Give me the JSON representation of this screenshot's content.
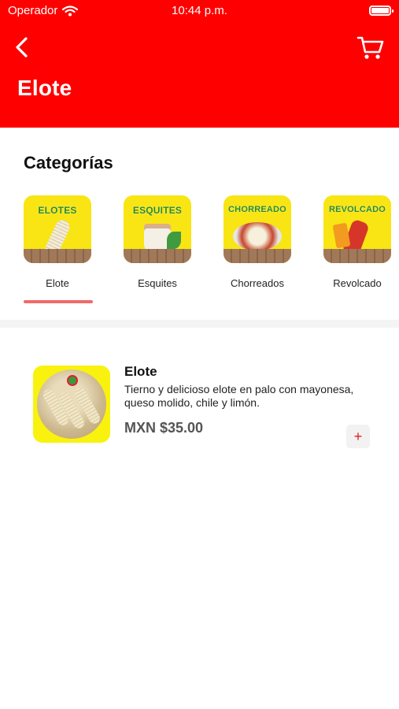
{
  "status_bar": {
    "carrier": "Operador",
    "time": "10:44 p.m."
  },
  "header": {
    "title": "Elote",
    "back_icon": "chevron-left-icon",
    "cart_icon": "cart-icon"
  },
  "categories_section": {
    "title": "Categorías",
    "selected_index": 0,
    "items": [
      {
        "label": "Elote",
        "image_text": "ELOTES"
      },
      {
        "label": "Esquites",
        "image_text": "ESQUITES"
      },
      {
        "label": "Chorreados",
        "image_text": "CHORREADO"
      },
      {
        "label": "Revolcado",
        "image_text": "REVOLCADO"
      }
    ]
  },
  "products": [
    {
      "name": "Elote",
      "description": "Tierno y delicioso elote en palo con mayonesa, queso molido, chile y limón.",
      "price": "MXN $35.00",
      "add_label": "+"
    }
  ],
  "colors": {
    "brand_red": "#ff0000",
    "category_yellow": "#f9e514",
    "underline": "#f06a6a",
    "add_plus": "#e21b1b"
  }
}
